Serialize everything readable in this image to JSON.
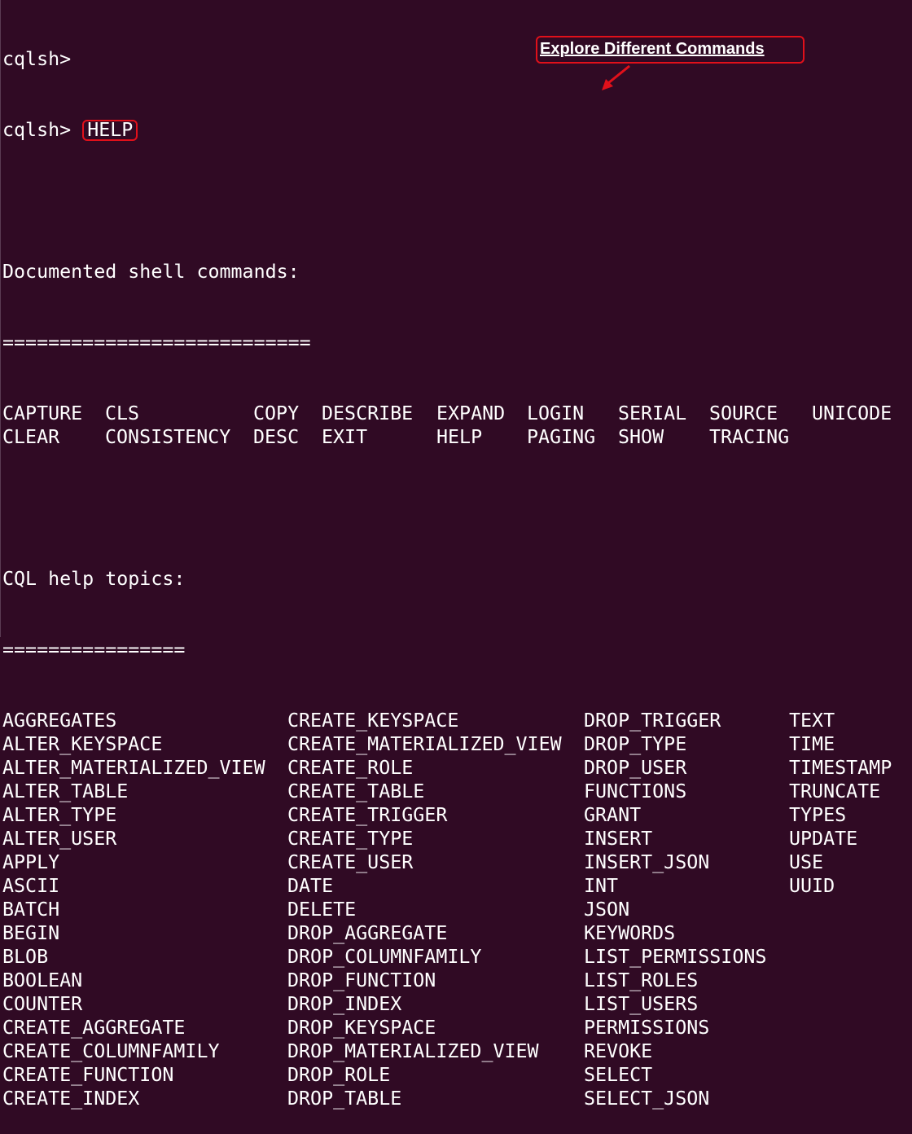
{
  "terminal": {
    "prompt_lines": [
      {
        "prompt": "cqlsh>",
        "command": ""
      },
      {
        "prompt": "cqlsh>",
        "command": "HELP"
      }
    ],
    "shell_section": {
      "heading": "Documented shell commands:",
      "underline": "===========================",
      "rows": [
        [
          "CAPTURE",
          "CLS",
          "COPY",
          "DESCRIBE",
          "EXPAND",
          "LOGIN",
          "SERIAL",
          "SOURCE",
          "UNICODE"
        ],
        [
          "CLEAR",
          "CONSISTENCY",
          "DESC",
          "EXIT",
          "HELP",
          "PAGING",
          "SHOW",
          "TRACING",
          ""
        ]
      ]
    },
    "cql_section": {
      "heading": "CQL help topics:",
      "underline": "================",
      "rows": [
        [
          "AGGREGATES",
          "CREATE_KEYSPACE",
          "DROP_TRIGGER",
          "TEXT"
        ],
        [
          "ALTER_KEYSPACE",
          "CREATE_MATERIALIZED_VIEW",
          "DROP_TYPE",
          "TIME"
        ],
        [
          "ALTER_MATERIALIZED_VIEW",
          "CREATE_ROLE",
          "DROP_USER",
          "TIMESTAMP"
        ],
        [
          "ALTER_TABLE",
          "CREATE_TABLE",
          "FUNCTIONS",
          "TRUNCATE"
        ],
        [
          "ALTER_TYPE",
          "CREATE_TRIGGER",
          "GRANT",
          "TYPES"
        ],
        [
          "ALTER_USER",
          "CREATE_TYPE",
          "INSERT",
          "UPDATE"
        ],
        [
          "APPLY",
          "CREATE_USER",
          "INSERT_JSON",
          "USE"
        ],
        [
          "ASCII",
          "DATE",
          "INT",
          "UUID"
        ],
        [
          "BATCH",
          "DELETE",
          "JSON",
          ""
        ],
        [
          "BEGIN",
          "DROP_AGGREGATE",
          "KEYWORDS",
          ""
        ],
        [
          "BLOB",
          "DROP_COLUMNFAMILY",
          "LIST_PERMISSIONS",
          ""
        ],
        [
          "BOOLEAN",
          "DROP_FUNCTION",
          "LIST_ROLES",
          ""
        ],
        [
          "COUNTER",
          "DROP_INDEX",
          "LIST_USERS",
          ""
        ],
        [
          "CREATE_AGGREGATE",
          "DROP_KEYSPACE",
          "PERMISSIONS",
          ""
        ],
        [
          "CREATE_COLUMNFAMILY",
          "DROP_MATERIALIZED_VIEW",
          "REVOKE",
          ""
        ],
        [
          "CREATE_FUNCTION",
          "DROP_ROLE",
          "SELECT",
          ""
        ],
        [
          "CREATE_INDEX",
          "DROP_TABLE",
          "SELECT_JSON",
          ""
        ]
      ]
    }
  },
  "annotation": {
    "label": "Explore Different Commands",
    "color": "#e0101a"
  },
  "theme": {
    "background": "#300a24",
    "foreground": "#ffffff"
  }
}
